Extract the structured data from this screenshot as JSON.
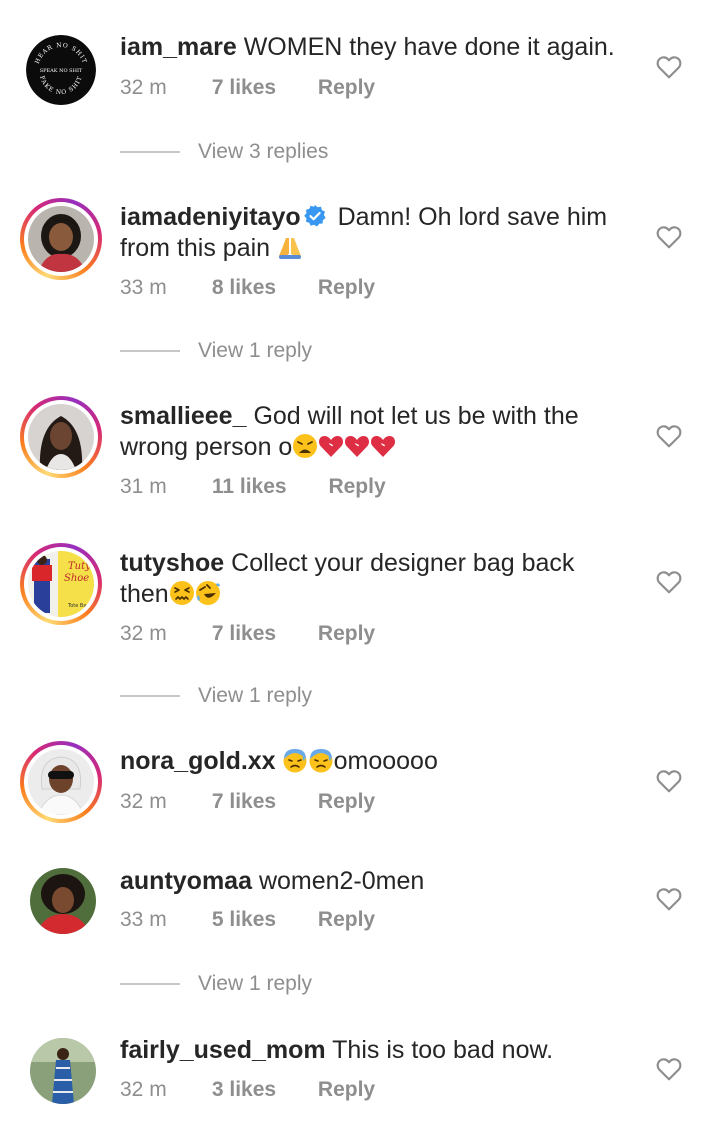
{
  "comments": [
    {
      "username": "iam_mare",
      "text": "WOMEN they have done it again.",
      "time": "32 m",
      "likes": "7 likes",
      "reply": "Reply",
      "avatar_text": [
        "HEAR NO SHIT",
        "SPEAK NO SHIT",
        "FAKE NO SHIT"
      ]
    },
    {
      "username": "iamadeniyitayo",
      "text_1": "Damn! Oh lord save him",
      "text_2": "from this pain",
      "time": "33 m",
      "likes": "8 likes",
      "reply": "Reply",
      "emoji": "folded-hands"
    },
    {
      "username": "smallieee_",
      "text_1": "God will not let us be with the",
      "text_2": "wrong person o",
      "time": "31 m",
      "likes": "11 likes",
      "reply": "Reply",
      "emojis": [
        "weary-face",
        "broken-heart",
        "broken-heart",
        "broken-heart"
      ]
    },
    {
      "username": "tutyshoe",
      "text_1": "Collect your designer bag back",
      "text_2": "then",
      "time": "32 m",
      "likes": "7 likes",
      "reply": "Reply",
      "emojis": [
        "confounded-face",
        "rolling-on-floor-laughing"
      ],
      "avatar_text": [
        "Tuty",
        "Shoe",
        "Tote Bag"
      ]
    },
    {
      "username": "nora_gold.xx",
      "text": "omooooo",
      "time": "32 m",
      "likes": "7 likes",
      "reply": "Reply",
      "emojis": [
        "downcast-face-with-sweat",
        "downcast-face-with-sweat"
      ]
    },
    {
      "username": "auntyomaa",
      "text": "women2-0men",
      "time": "33 m",
      "likes": "5 likes",
      "reply": "Reply"
    },
    {
      "username": "fairly_used_mom",
      "text": "This is too bad now.",
      "time": "32 m",
      "likes": "3 likes",
      "reply": "Reply"
    }
  ],
  "view_replies": {
    "r1": "View 3 replies",
    "r2": "View 1 reply",
    "r3": "View 1 reply",
    "r4": "View 1 reply"
  },
  "icons": {
    "heart": "heart-outline-icon",
    "verified": "verified-badge-icon"
  },
  "colors": {
    "username": "#262626",
    "secondary": "#8e8e8e",
    "verified": "#3897f0",
    "divider": "#c7c7c7"
  }
}
